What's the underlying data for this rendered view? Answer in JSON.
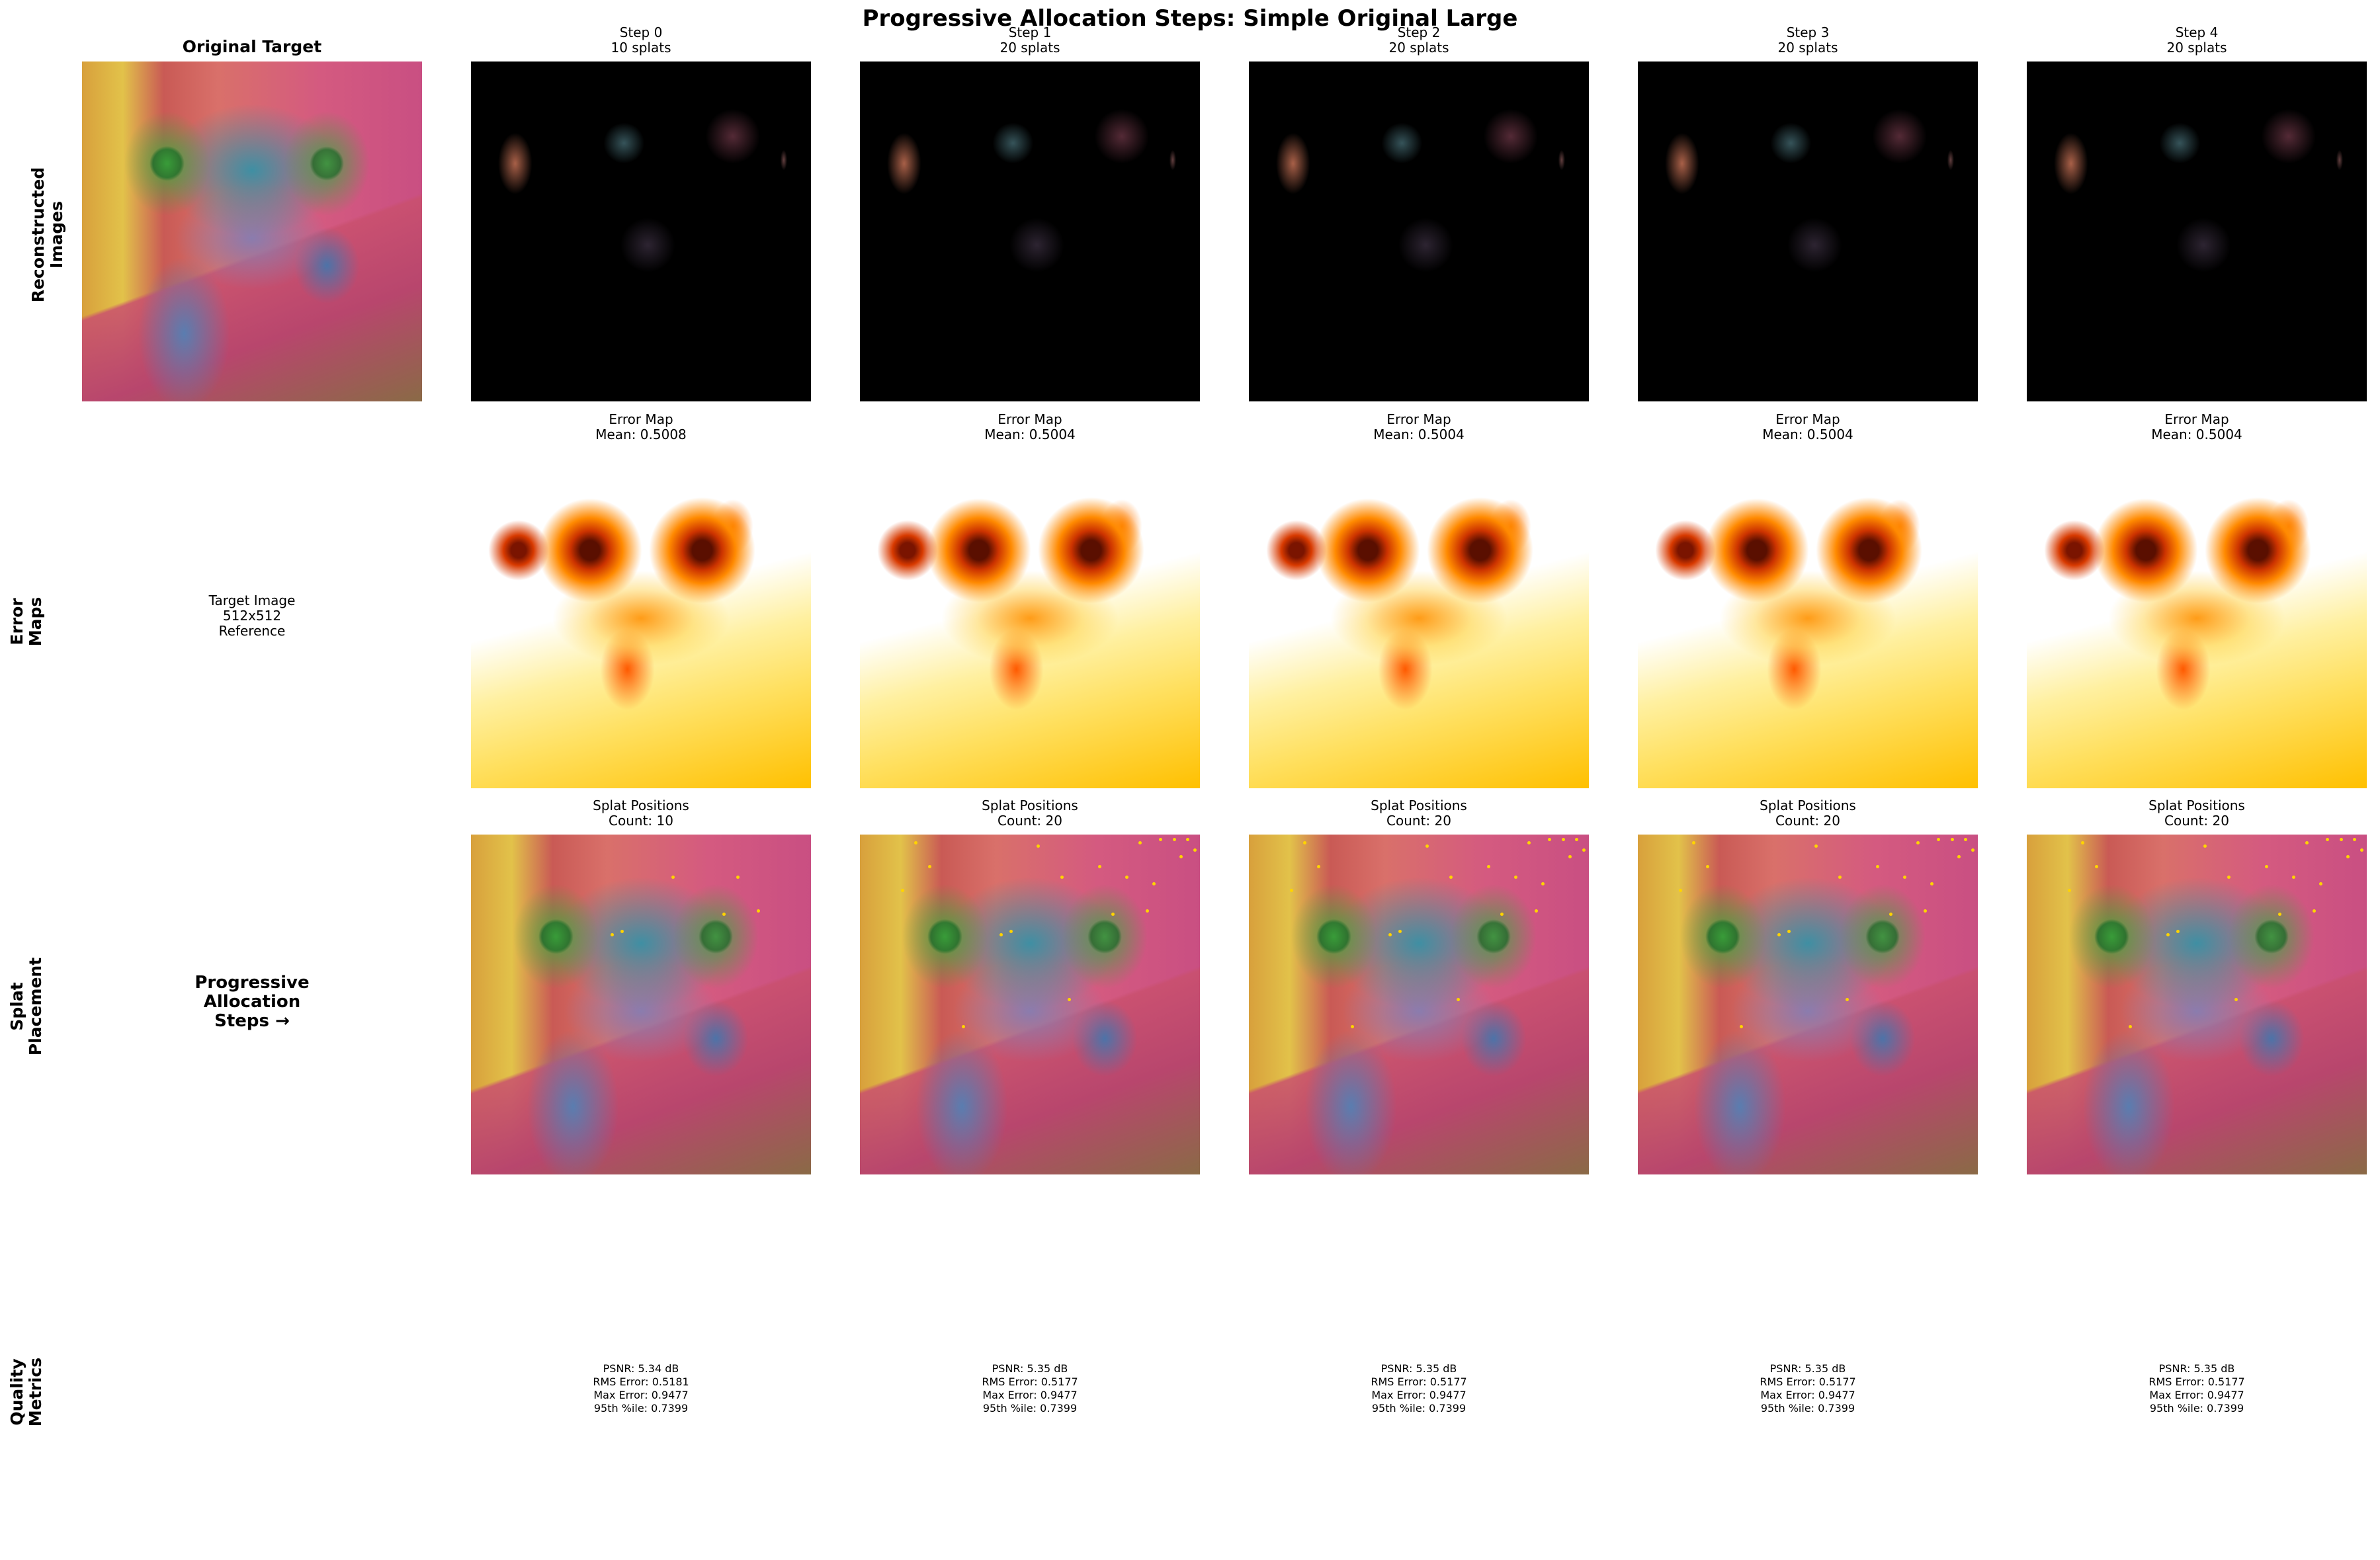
{
  "suptitle": "Progressive Allocation Steps: Simple Original Large",
  "row_labels": {
    "reconstructed": "Reconstructed\nImages",
    "error": "Error\nMaps",
    "splat": "Splat\nPlacement",
    "quality": "Quality\nMetrics"
  },
  "original": {
    "title": "Original Target",
    "target_text": "Target Image\n512x512\nReference",
    "progressive_text": "Progressive\nAllocation\nSteps →"
  },
  "steps": [
    {
      "title": "Step 0\n10 splats",
      "error_title": "Error Map\nMean: 0.5008",
      "splat_title": "Splat Positions\nCount: 10",
      "metrics": "PSNR: 5.34 dB\nRMS Error: 0.5181\nMax Error: 0.9477\n95th %ile: 0.7399"
    },
    {
      "title": "Step 1\n20 splats",
      "error_title": "Error Map\nMean: 0.5004",
      "splat_title": "Splat Positions\nCount: 20",
      "metrics": "PSNR: 5.35 dB\nRMS Error: 0.5177\nMax Error: 0.9477\n95th %ile: 0.7399"
    },
    {
      "title": "Step 2\n20 splats",
      "error_title": "Error Map\nMean: 0.5004",
      "splat_title": "Splat Positions\nCount: 20",
      "metrics": "PSNR: 5.35 dB\nRMS Error: 0.5177\nMax Error: 0.9477\n95th %ile: 0.7399"
    },
    {
      "title": "Step 3\n20 splats",
      "error_title": "Error Map\nMean: 0.5004",
      "splat_title": "Splat Positions\nCount: 20",
      "metrics": "PSNR: 5.35 dB\nRMS Error: 0.5177\nMax Error: 0.9477\n95th %ile: 0.7399"
    },
    {
      "title": "Step 4\n20 splats",
      "error_title": "Error Map\nMean: 0.5004",
      "splat_title": "Splat Positions\nCount: 20",
      "metrics": "PSNR: 5.35 dB\nRMS Error: 0.5177\nMax Error: 0.9477\n95th %ile: 0.7399"
    }
  ],
  "colors": {
    "splat_marker": "#ffd400",
    "reconstruction_background": "#000000"
  }
}
